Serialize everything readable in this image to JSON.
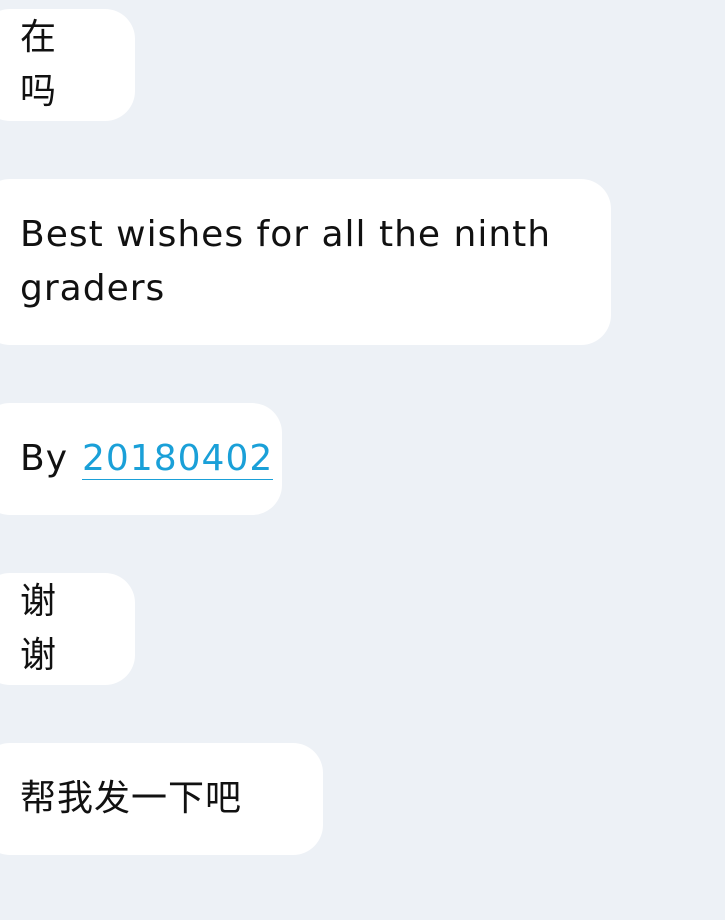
{
  "messages": [
    {
      "text": "在吗"
    },
    {
      "text": "Best wishes for all the ninth graders"
    },
    {
      "prefix": "By",
      "link": "20180402"
    },
    {
      "text": "谢谢"
    },
    {
      "text": "帮我发一下吧"
    }
  ],
  "colors": {
    "background": "#edf1f6",
    "bubble": "#ffffff",
    "text": "#111111",
    "link": "#1aa0d8"
  }
}
